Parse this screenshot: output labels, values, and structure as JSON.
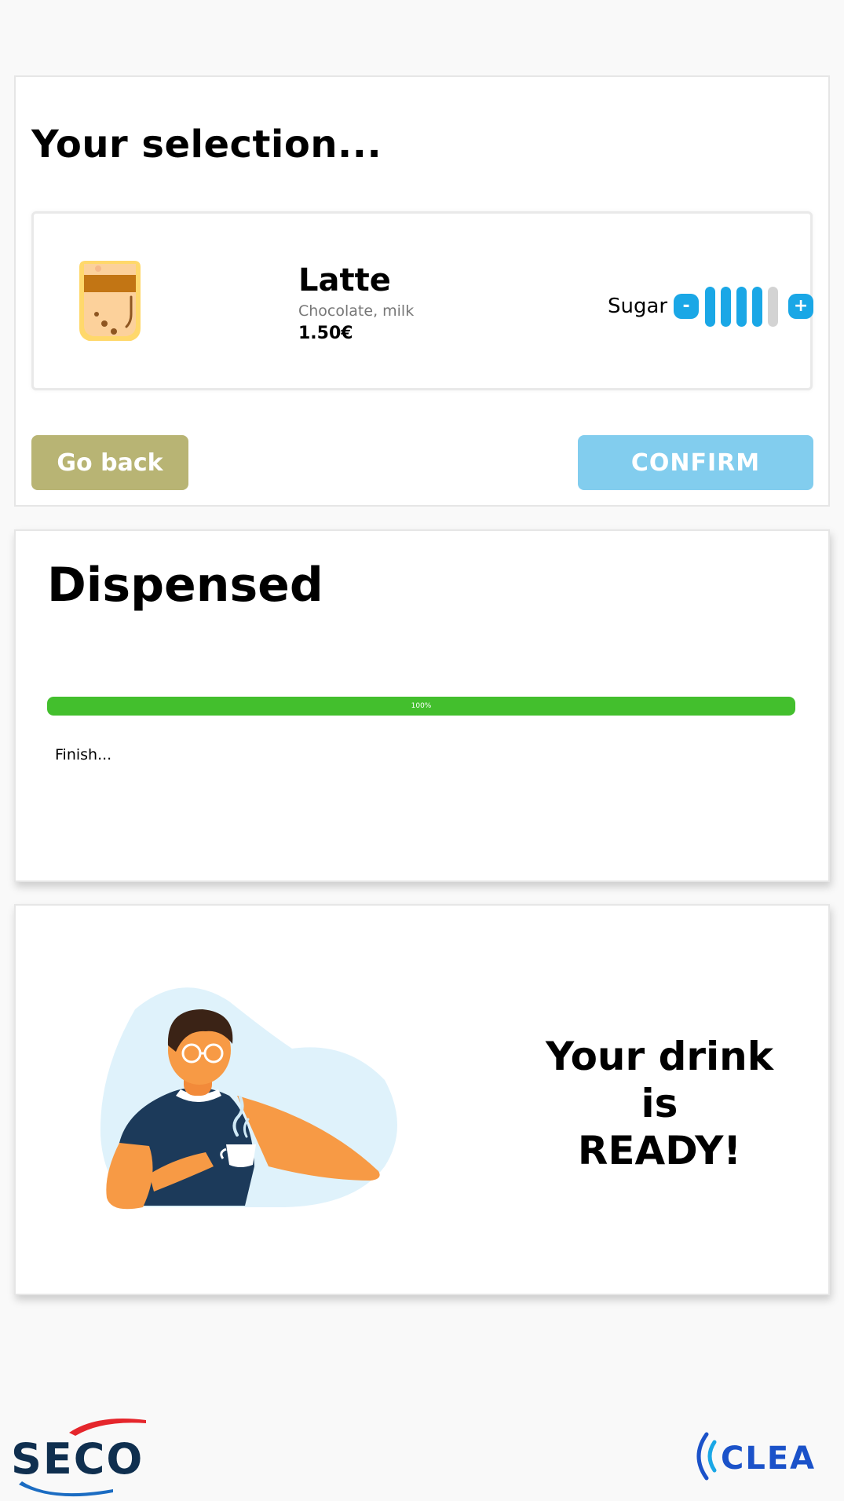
{
  "selection": {
    "title": "Your selection...",
    "product": {
      "name": "Latte",
      "description": "Chocolate, milk",
      "price": "1.50€",
      "icon": "latte-cup-icon"
    },
    "sugar": {
      "label": "Sugar",
      "minus_label": "-",
      "plus_label": "+",
      "level": 4,
      "max_level": 5
    },
    "back_label": "Go back",
    "confirm_label": "CONFIRM"
  },
  "dispensing": {
    "title": "Dispensed",
    "progress_percent": 100,
    "progress_label": "100%",
    "status": "Finish..."
  },
  "ready": {
    "line1": "Your drink",
    "line2": "is",
    "line3": "READY!"
  },
  "footer": {
    "left_logo": "SECO",
    "right_logo": "CLEA"
  },
  "colors": {
    "accent_blue": "#1aa7e6",
    "confirm_blue": "#82cdee",
    "back_olive": "#b8b474",
    "progress_green": "#43bf2d"
  }
}
